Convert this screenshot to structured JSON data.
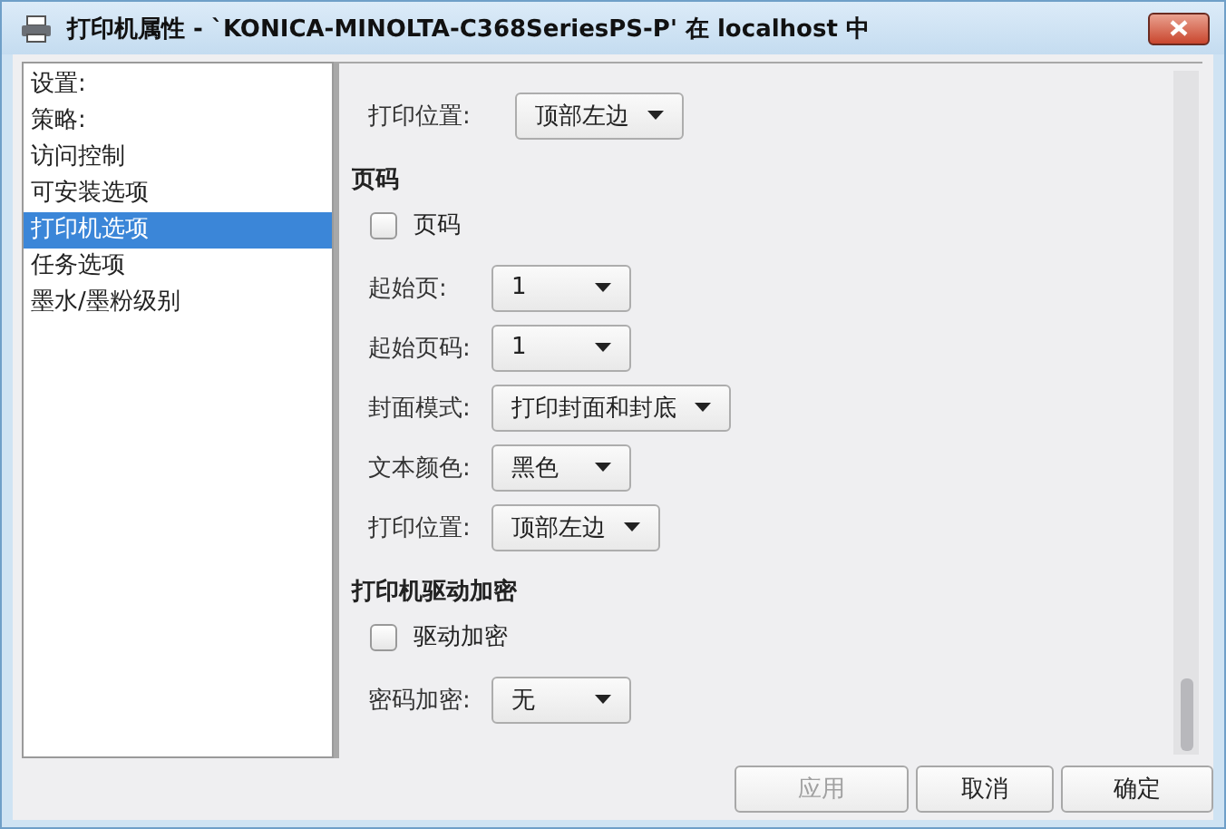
{
  "window": {
    "title": "打印机属性 - `KONICA-MINOLTA-C368SeriesPS-P' 在 localhost 中"
  },
  "sidebar": {
    "items": [
      {
        "label": "设置:",
        "selected": false
      },
      {
        "label": "策略:",
        "selected": false
      },
      {
        "label": "访问控制",
        "selected": false
      },
      {
        "label": "可安装选项",
        "selected": false
      },
      {
        "label": "打印机选项",
        "selected": true
      },
      {
        "label": "任务选项",
        "selected": false
      },
      {
        "label": "墨水/墨粉级别",
        "selected": false
      }
    ]
  },
  "sections": [
    {
      "rows": [
        {
          "kind": "combo",
          "label": "打印位置:",
          "value": "顶部左边"
        }
      ]
    },
    {
      "heading": "页码",
      "rows": [
        {
          "kind": "checkbox",
          "label": "页码",
          "checked": false
        },
        {
          "kind": "combo",
          "label": "起始页:",
          "value": "1"
        },
        {
          "kind": "combo",
          "label": "起始页码:",
          "value": "1"
        },
        {
          "kind": "combo",
          "label": "封面模式:",
          "value": "打印封面和封底"
        },
        {
          "kind": "combo",
          "label": "文本颜色:",
          "value": "黑色"
        },
        {
          "kind": "combo",
          "label": "打印位置:",
          "value": "顶部左边"
        }
      ]
    },
    {
      "heading": "打印机驱动加密",
      "rows": [
        {
          "kind": "checkbox",
          "label": "驱动加密",
          "checked": false
        },
        {
          "kind": "combo",
          "label": "密码加密:",
          "value": "无"
        }
      ]
    }
  ],
  "buttons": [
    {
      "label": "应用",
      "disabled": true
    },
    {
      "label": "取消",
      "disabled": false
    },
    {
      "label": "确定",
      "disabled": false
    }
  ]
}
